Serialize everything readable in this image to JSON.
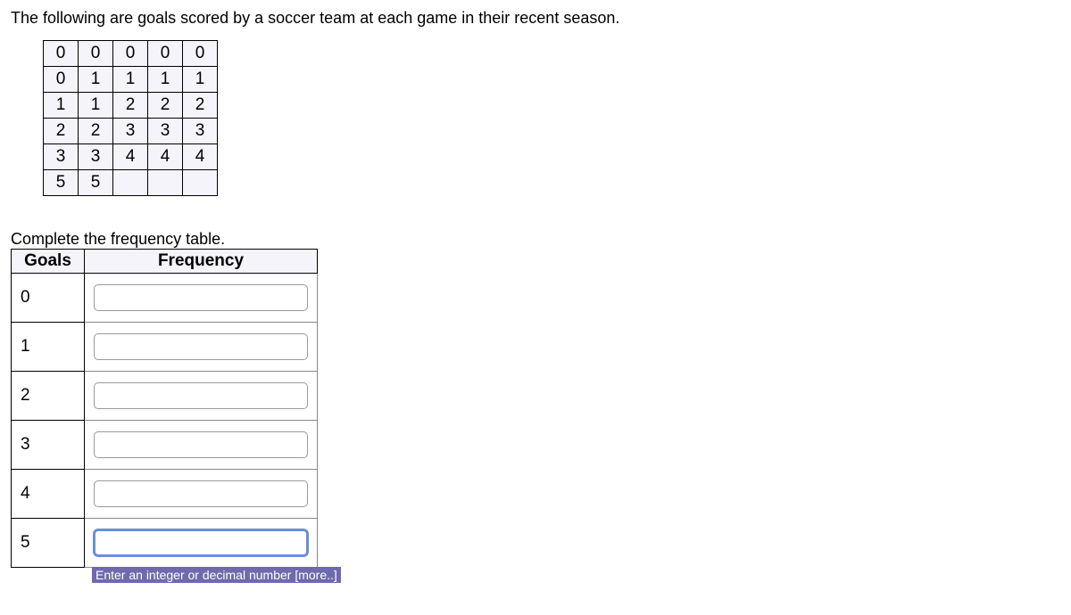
{
  "intro_text": "The following are goals scored by a soccer team at each game in their recent season.",
  "data_grid": [
    [
      "0",
      "0",
      "0",
      "0",
      "0"
    ],
    [
      "0",
      "1",
      "1",
      "1",
      "1"
    ],
    [
      "1",
      "1",
      "2",
      "2",
      "2"
    ],
    [
      "2",
      "2",
      "3",
      "3",
      "3"
    ],
    [
      "3",
      "3",
      "4",
      "4",
      "4"
    ],
    [
      "5",
      "5",
      "",
      "",
      ""
    ]
  ],
  "instruction_text": "Complete the frequency table.",
  "freq_headers": {
    "goals": "Goals",
    "frequency": "Frequency"
  },
  "freq_rows": [
    {
      "goal": "0",
      "value": ""
    },
    {
      "goal": "1",
      "value": ""
    },
    {
      "goal": "2",
      "value": ""
    },
    {
      "goal": "3",
      "value": ""
    },
    {
      "goal": "4",
      "value": ""
    },
    {
      "goal": "5",
      "value": ""
    }
  ],
  "tooltip_text": "Enter an integer or decimal number [more..]"
}
